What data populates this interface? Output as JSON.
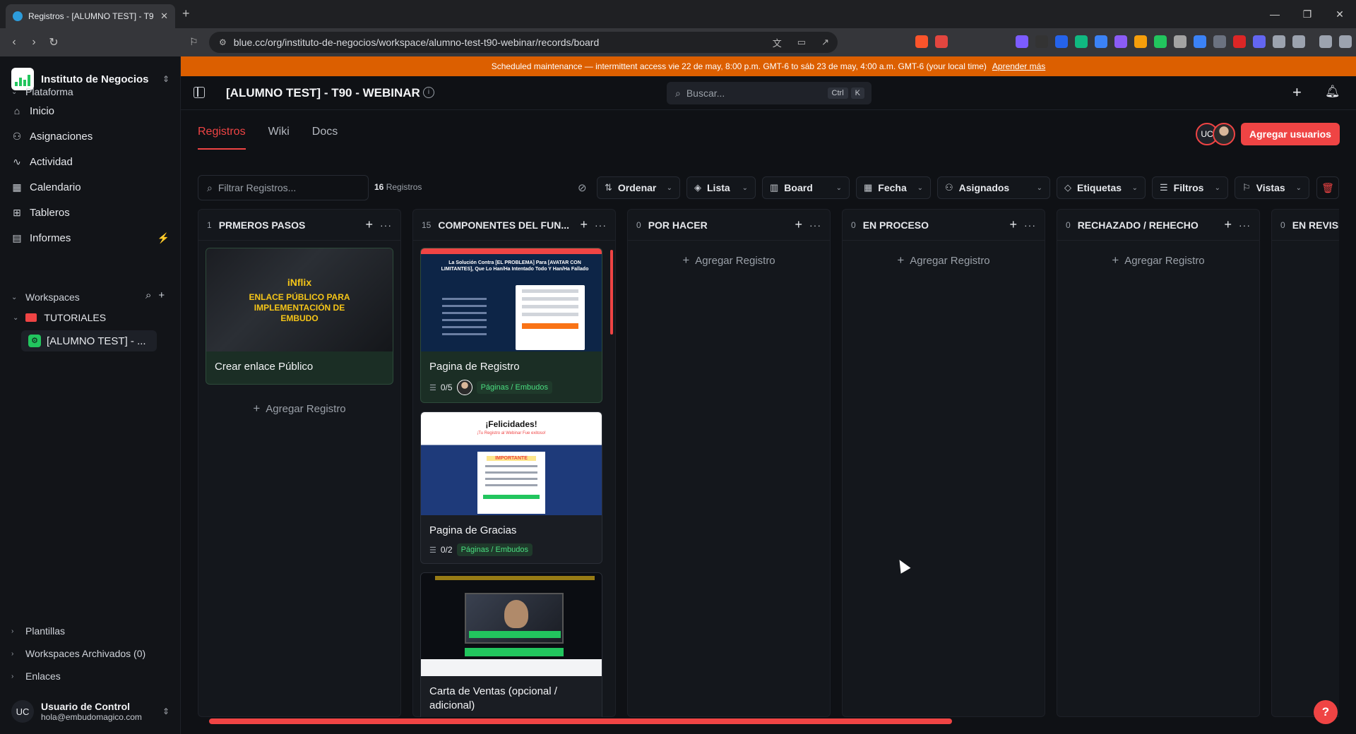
{
  "browser": {
    "tab_title": "Registros - [ALUMNO TEST] - T9",
    "url": "blue.cc/org/instituto-de-negocios/workspace/alumno-test-t90-webinar/records/board"
  },
  "sidebar": {
    "org_name": "Instituto de Negocios",
    "section_platform": "Plataforma",
    "nav": [
      {
        "label": "Inicio",
        "icon": "home-icon"
      },
      {
        "label": "Asignaciones",
        "icon": "user-icon"
      },
      {
        "label": "Actividad",
        "icon": "activity-icon"
      },
      {
        "label": "Calendario",
        "icon": "calendar-icon"
      },
      {
        "label": "Tableros",
        "icon": "grid-icon"
      },
      {
        "label": "Informes",
        "icon": "report-icon"
      }
    ],
    "section_workspaces": "Workspaces",
    "folder": "TUTORIALES",
    "workspace_item": "[ALUMNO TEST] - ...",
    "bottom_sections": [
      "Plantillas",
      "Workspaces Archivados (0)",
      "Enlaces"
    ],
    "user": {
      "initials": "UC",
      "name": "Usuario de Control",
      "email": "hola@embudomagico.com"
    }
  },
  "banner": {
    "text": "Scheduled maintenance — intermittent access vie 22 de may, 8:00 p.m. GMT-6 to sáb 23 de may, 4:00 a.m. GMT-6 (your local time)",
    "link": "Aprender más"
  },
  "header": {
    "title": "[ALUMNO TEST] - T90 - WEBINAR",
    "search_placeholder": "Buscar...",
    "kbd": [
      "Ctrl",
      "K"
    ]
  },
  "subtabs": [
    "Registros",
    "Wiki",
    "Docs"
  ],
  "users": {
    "initials": "UC",
    "add_label": "Agregar usuarios"
  },
  "toolbar": {
    "filter_placeholder": "Filtrar Registros...",
    "count_num": "16",
    "count_label": "Registros",
    "buttons": [
      "Ordenar",
      "Lista",
      "Board",
      "Fecha",
      "Asignados",
      "Etiquetas",
      "Filtros",
      "Vistas"
    ]
  },
  "columns": [
    {
      "count": "1",
      "name": "PRMEROS PASOS"
    },
    {
      "count": "15",
      "name": "COMPONENTES DEL FUN..."
    },
    {
      "count": "0",
      "name": "POR HACER"
    },
    {
      "count": "0",
      "name": "EN PROCESO"
    },
    {
      "count": "0",
      "name": "RECHAZADO / REHECHO"
    },
    {
      "count": "0",
      "name": "EN REVISI"
    }
  ],
  "add_record": "Agregar Registro",
  "cards": {
    "c1": {
      "title": "Crear enlace Público",
      "thumb_brand": "iNflix",
      "thumb_headline": "ENLACE PÚBLICO PARA IMPLEMENTACIÓN DE EMBUDO"
    },
    "c2": {
      "title": "Pagina de Registro",
      "checks": "0/5",
      "tag": "Páginas / Embudos",
      "thumb_text": "La Solución Contra [EL PROBLEMA] Para [AVATAR CON LIMITANTES], Que Lo Han/Ha Intentado Todo Y Han/Ha Fallado"
    },
    "c3": {
      "title": "Pagina de Gracias",
      "checks": "0/2",
      "tag": "Páginas / Embudos",
      "thumb_title": "¡Felicidades!",
      "thumb_sub": "¡Tu Registro al Webinar Fue exitoso!",
      "thumb_box": "IMPORTANTE"
    },
    "c4": {
      "title": "Carta de Ventas (opcional / adicional)"
    }
  },
  "colors": {
    "accent": "#ef4444",
    "banner": "#dc5f00",
    "tag_green": "#4ade80",
    "bg": "#0f1115"
  }
}
